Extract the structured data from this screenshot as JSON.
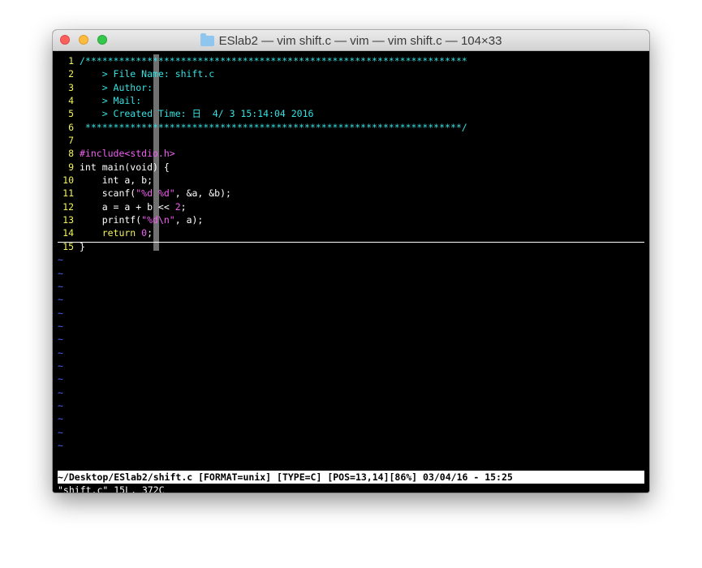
{
  "window": {
    "title": "ESlab2 — vim shift.c — vim — vim shift.c — 104×33"
  },
  "colors": {
    "background": "#000000",
    "line_number": "#f3f35a",
    "comment": "#35e1e1",
    "preproc": "#f25ef2",
    "tilde": "#4d63f5"
  },
  "editor": {
    "lines": [
      {
        "num": "1",
        "segments": [
          {
            "t": "/********************************************************************",
            "c": "cyan"
          }
        ]
      },
      {
        "num": "2",
        "segments": [
          {
            "t": "    > File Name: shift.c",
            "c": "cyan"
          }
        ]
      },
      {
        "num": "3",
        "segments": [
          {
            "t": "    > Author:",
            "c": "cyan"
          }
        ]
      },
      {
        "num": "4",
        "segments": [
          {
            "t": "    > Mail:",
            "c": "cyan"
          }
        ]
      },
      {
        "num": "5",
        "segments": [
          {
            "t": "    > Created Time: 日  4/ 3 15:14:04 2016",
            "c": "cyan"
          }
        ]
      },
      {
        "num": "6",
        "segments": [
          {
            "t": " *******************************************************************/",
            "c": "cyan"
          }
        ]
      },
      {
        "num": "7",
        "segments": []
      },
      {
        "num": "8",
        "segments": [
          {
            "t": "#include",
            "c": "magenta"
          },
          {
            "t": "<stdio.h>",
            "c": "magenta"
          }
        ]
      },
      {
        "num": "9",
        "segments": [
          {
            "t": "int main(void) {",
            "c": "white"
          }
        ]
      },
      {
        "num": "10",
        "segments": [
          {
            "t": "    int a, b;",
            "c": "white"
          }
        ]
      },
      {
        "num": "11",
        "segments": [
          {
            "t": "    scanf(",
            "c": "white"
          },
          {
            "t": "\"%d %d\"",
            "c": "magenta"
          },
          {
            "t": ", &a, &b);",
            "c": "white"
          }
        ]
      },
      {
        "num": "12",
        "segments": [
          {
            "t": "    a = a + b << ",
            "c": "white"
          },
          {
            "t": "2",
            "c": "magenta"
          },
          {
            "t": ";",
            "c": "white"
          }
        ]
      },
      {
        "num": "13",
        "segments": [
          {
            "t": "    printf(",
            "c": "white"
          },
          {
            "t": "\"%d\\n\"",
            "c": "magenta"
          },
          {
            "t": ", a);",
            "c": "white"
          }
        ]
      },
      {
        "num": "14",
        "segments": [
          {
            "t": "    return ",
            "c": "yellow"
          },
          {
            "t": "0",
            "c": "magenta"
          },
          {
            "t": ";",
            "c": "white"
          }
        ]
      },
      {
        "num": "15",
        "segments": [
          {
            "t": "}",
            "c": "white"
          }
        ]
      }
    ],
    "empty_marker": "~",
    "empty_line_count": 15
  },
  "statusline": "~/Desktop/ESlab2/shift.c [FORMAT=unix] [TYPE=C] [POS=13,14][86%] 03/04/16 - 15:25",
  "cmdline": "\"shift.c\" 15L, 372C"
}
